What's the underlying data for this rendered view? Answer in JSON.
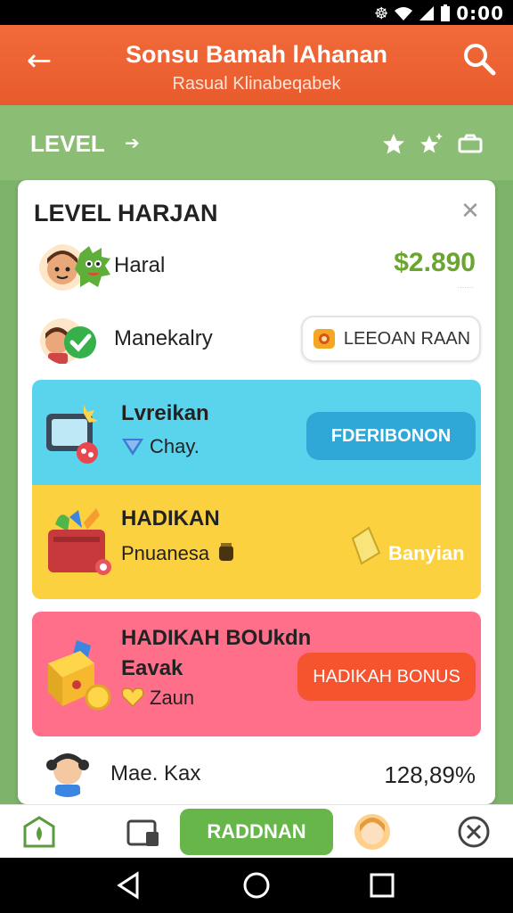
{
  "status_bar": {
    "time": "0:00",
    "icons": [
      "notification-icon",
      "wifi-icon",
      "signal-icon",
      "battery-icon"
    ]
  },
  "app_bar": {
    "title": "Sonsu Bamah lAhanan",
    "subtitle": "Rasual Klinabeqabek",
    "icons": [
      "back-arrow-icon",
      "search-icon"
    ]
  },
  "level_bar": {
    "label": "LEVEL",
    "arrow": "➔",
    "icons": [
      "star-icon",
      "star-sparkle-icon",
      "wallet-icon"
    ]
  },
  "card": {
    "title": "LEVEL HARJAN",
    "close": "✕",
    "rows": [
      {
        "name": "Haral",
        "amount": "$2.890"
      },
      {
        "name": "Manekalry",
        "button_label": "LEEOAN RAAN"
      }
    ],
    "bands": [
      {
        "title": "Lvreikan",
        "sub": "Chay.",
        "cta": "FDERIBONON",
        "color": "#5ad3ec",
        "cta_color": "#2fa8d8"
      },
      {
        "title": "HADIKAN",
        "sub": "Pnuanesa",
        "cta": "Banyian",
        "color": "#fbd13f"
      },
      {
        "title": "HADIKAH BOUkdn",
        "title2": "Eavak",
        "sub": "Zaun",
        "cta": "HADIKAH BONUS",
        "color": "#ff6f8a",
        "cta_color": "#f5542f"
      }
    ],
    "footer_row": {
      "name": "Mae. Kax",
      "value": "128,89%"
    }
  },
  "bottom_nav": {
    "primary_label": "RADDNAN",
    "icons": [
      "home-icon",
      "shop-icon",
      "avatar-icon",
      "settings-icon"
    ]
  },
  "colors": {
    "app_bar": "#e85a2c",
    "background": "#7db36b",
    "primary": "#66b64a",
    "money": "#6aa530"
  }
}
